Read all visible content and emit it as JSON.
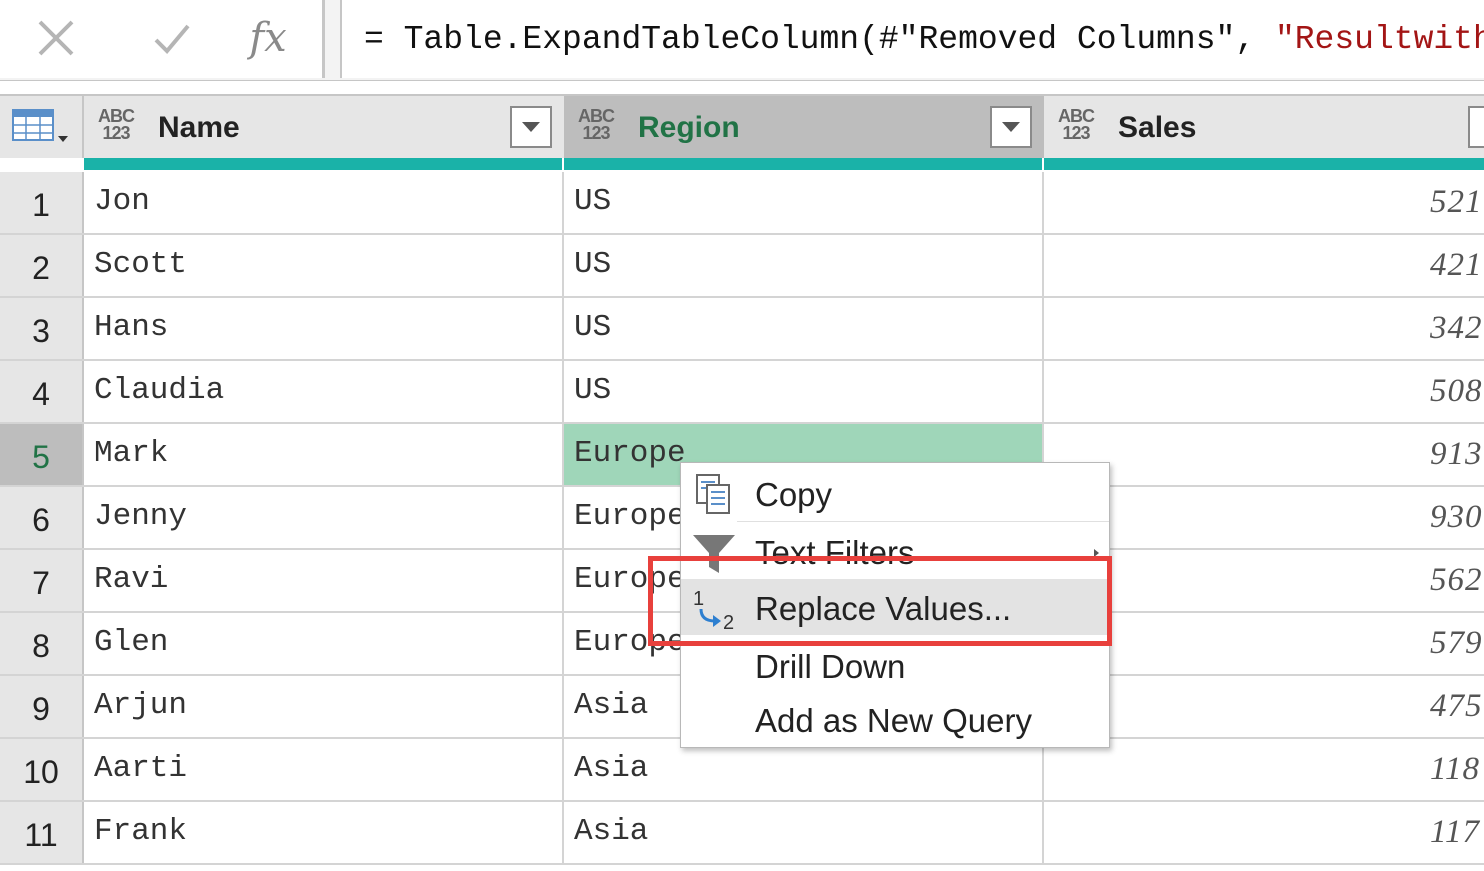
{
  "formula_bar": {
    "cancel_icon": "x-icon",
    "commit_icon": "check-icon",
    "fx_label": "fx",
    "formula_prefix": "= Table.ExpandTableColumn(#\"Removed Columns\", ",
    "formula_string": "\"Resultwith"
  },
  "columns": [
    {
      "type_top": "ABC",
      "type_bottom": "123",
      "title": "Name"
    },
    {
      "type_top": "ABC",
      "type_bottom": "123",
      "title": "Region"
    },
    {
      "type_top": "ABC",
      "type_bottom": "123",
      "title": "Sales"
    }
  ],
  "rows": [
    {
      "num": "1",
      "name": "Jon",
      "region": "US",
      "sales": "521"
    },
    {
      "num": "2",
      "name": "Scott",
      "region": "US",
      "sales": "421"
    },
    {
      "num": "3",
      "name": "Hans",
      "region": "US",
      "sales": "342"
    },
    {
      "num": "4",
      "name": "Claudia",
      "region": "US",
      "sales": "508"
    },
    {
      "num": "5",
      "name": "Mark",
      "region": "Europe",
      "sales": "913"
    },
    {
      "num": "6",
      "name": "Jenny",
      "region": "Europe",
      "sales": "930"
    },
    {
      "num": "7",
      "name": "Ravi",
      "region": "Europe",
      "sales": "562"
    },
    {
      "num": "8",
      "name": "Glen",
      "region": "Europe",
      "sales": "579"
    },
    {
      "num": "9",
      "name": "Arjun",
      "region": "Asia",
      "sales": "475"
    },
    {
      "num": "10",
      "name": "Aarti",
      "region": "Asia",
      "sales": "118"
    },
    {
      "num": "11",
      "name": "Frank",
      "region": "Asia",
      "sales": "117"
    }
  ],
  "context_menu": {
    "items": [
      {
        "label": "Copy",
        "icon": "copy-icon"
      },
      {
        "label": "Text Filters",
        "icon": "filter-icon"
      },
      {
        "label": "Replace Values...",
        "icon": "replace-values-icon"
      },
      {
        "label": "Drill Down",
        "icon": ""
      },
      {
        "label": "Add as New Query",
        "icon": ""
      }
    ]
  },
  "colors": {
    "accent_teal": "#1ab2a8",
    "selected_green": "#217346",
    "highlight_cell": "#9fd6b9",
    "annotation_red": "#e8403c"
  }
}
